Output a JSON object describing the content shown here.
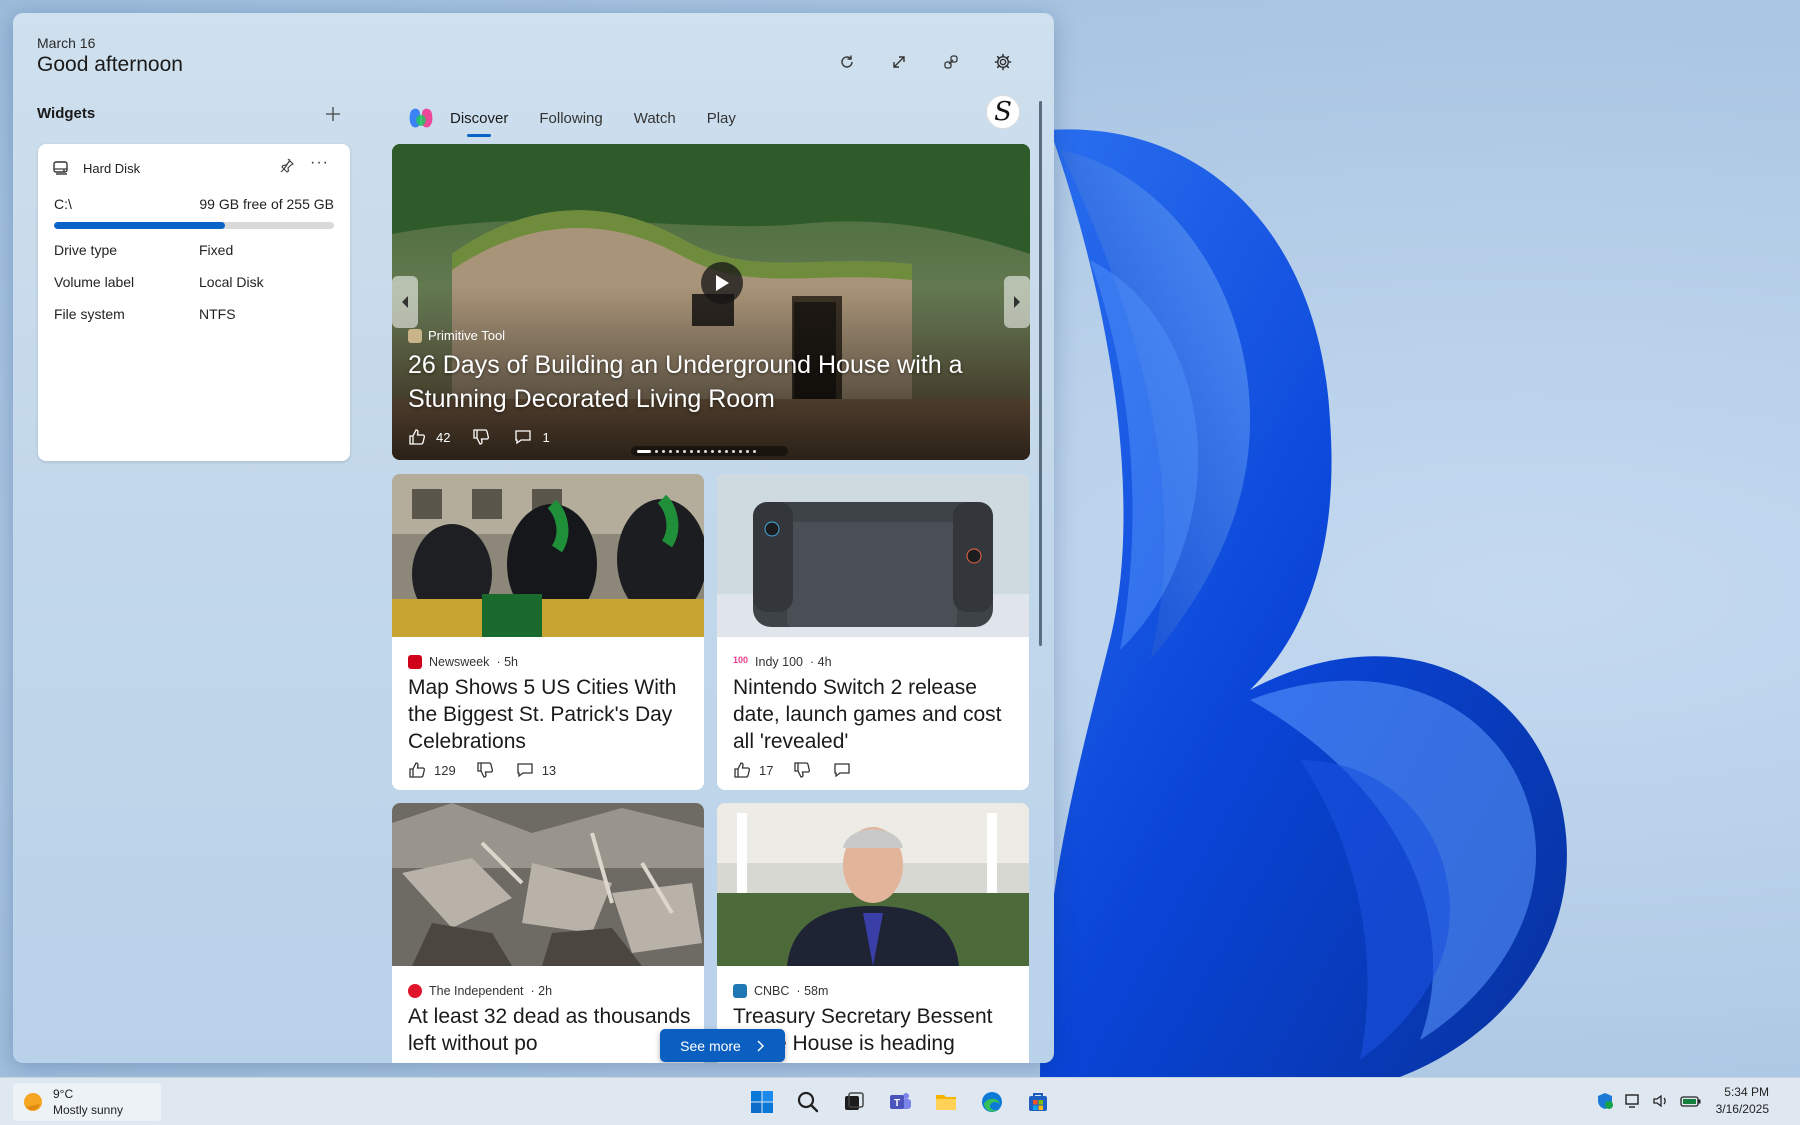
{
  "header": {
    "date": "March 16",
    "greeting": "Good afternoon"
  },
  "widgets": {
    "title": "Widgets"
  },
  "hard_disk": {
    "title": "Hard Disk",
    "drive": "C:\\",
    "free_text": "99 GB free of 255 GB",
    "used_fraction": 0.61,
    "rows": [
      {
        "label": "Drive type",
        "value": "Fixed"
      },
      {
        "label": "Volume label",
        "value": "Local Disk"
      },
      {
        "label": "File system",
        "value": "NTFS"
      }
    ]
  },
  "tabs": [
    "Discover",
    "Following",
    "Watch",
    "Play"
  ],
  "active_tab": "Discover",
  "avatar_letter": "S",
  "hero": {
    "source": "Primitive Tool",
    "title": "26 Days of Building an Underground House with a Stunning Decorated Living Room",
    "likes": "42",
    "comments": "1",
    "slide_count": 16,
    "active_slide": 0
  },
  "cards": [
    {
      "source": "Newsweek",
      "time": "5h",
      "title": "Map Shows 5 US Cities With the Biggest St. Patrick's Day Celebrations",
      "likes": "129",
      "comments": "13",
      "src_color": "#d0021b"
    },
    {
      "source": "Indy 100",
      "time": "4h",
      "title": "Nintendo Switch 2 release date, launch games and cost all 'revealed'",
      "likes": "17",
      "comments": "",
      "src_color": "#e83e8c"
    },
    {
      "source": "The Independent",
      "time": "2h",
      "title": "At least 32 dead as thousands left without po",
      "likes": "",
      "comments": "",
      "src_color": "#e0152b"
    },
    {
      "source": "CNBC",
      "time": "58m",
      "title": "Treasury Secretary Bessent  White House is heading",
      "likes": "",
      "comments": "",
      "src_color": "#1f77b4"
    }
  ],
  "see_more": "See more",
  "taskbar": {
    "temp": "9°C",
    "condition": "Mostly sunny",
    "time": "5:34 PM",
    "date": "3/16/2025"
  },
  "accent": "#0a64c8"
}
